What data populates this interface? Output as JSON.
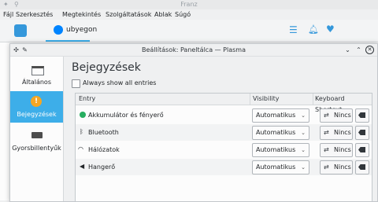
{
  "franz": {
    "title": "Franz",
    "menu": [
      "Fájl",
      "Szerkesztés",
      "Megtekintés",
      "Szolgáltatások",
      "Ablak",
      "Súgó"
    ],
    "tab_label": "ubyegon",
    "accent": "#3598db"
  },
  "dialog": {
    "title": "Beállítások: Paneltálca — Plasma",
    "sidebar": [
      {
        "label": "Általános",
        "icon": "window-icon",
        "selected": false
      },
      {
        "label": "Bejegyzések",
        "icon": "info-icon",
        "selected": true
      },
      {
        "label": "Gyorsbillentyűk",
        "icon": "keyboard-icon",
        "selected": false
      }
    ],
    "page_title": "Bejegyzések",
    "always_show_label": "Always show all entries",
    "always_show_checked": false,
    "columns": [
      "Entry",
      "Visibility",
      "Keyboard Shortcut"
    ],
    "rows": [
      {
        "entry": "Akkumulátor és fényerő",
        "icon": "battery-icon",
        "visibility": "Automatikus",
        "shortcut": "Nincs"
      },
      {
        "entry": "Bluetooth",
        "icon": "bluetooth-icon",
        "visibility": "Automatikus",
        "shortcut": "Nincs"
      },
      {
        "entry": "Hálózatok",
        "icon": "wifi-icon",
        "visibility": "Automatikus",
        "shortcut": "Nincs"
      },
      {
        "entry": "Hangerő",
        "icon": "speaker-icon",
        "visibility": "Automatikus",
        "shortcut": "Nincs"
      }
    ],
    "selection_color": "#3daee9"
  }
}
